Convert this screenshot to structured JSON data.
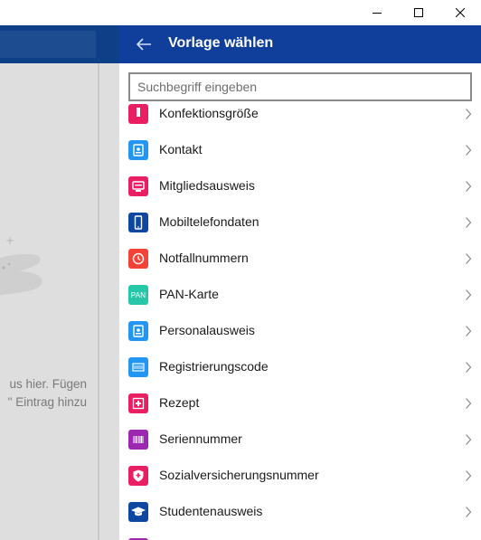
{
  "window": {
    "minimize_icon": "minimize-icon",
    "maximize_icon": "maximize-icon",
    "close_icon": "close-icon"
  },
  "background": {
    "text_line1": "us hier. Fügen",
    "text_line2": "\" Eintrag hinzu"
  },
  "panel": {
    "title": "Vorlage wählen",
    "back_icon": "arrow-left-icon",
    "search_placeholder": "Suchbegriff eingeben",
    "search_value": ""
  },
  "templates": [
    {
      "label": "Konfektionsgröße",
      "color": "#e91e63",
      "icon": "tshirt-icon"
    },
    {
      "label": "Kontakt",
      "color": "#2196f3",
      "icon": "contact-card-icon"
    },
    {
      "label": "Mitgliedsausweis",
      "color": "#e91e63",
      "icon": "membership-card-icon"
    },
    {
      "label": "Mobiltelefondaten",
      "color": "#0d47a1",
      "icon": "mobile-phone-icon"
    },
    {
      "label": "Notfallnummern",
      "color": "#f44336",
      "icon": "clock-icon"
    },
    {
      "label": "PAN-Karte",
      "color": "#26c6a8",
      "icon": "pan-icon",
      "icon_text": "PAN"
    },
    {
      "label": "Personalausweis",
      "color": "#2196f3",
      "icon": "id-card-icon"
    },
    {
      "label": "Registrierungscode",
      "color": "#2196f3",
      "icon": "registration-code-icon"
    },
    {
      "label": "Rezept",
      "color": "#e91e63",
      "icon": "medical-cross-icon"
    },
    {
      "label": "Seriennummer",
      "color": "#9c27b0",
      "icon": "barcode-icon"
    },
    {
      "label": "Sozialversicherungsnummer",
      "color": "#e91e63",
      "icon": "shield-icon"
    },
    {
      "label": "Studentenausweis",
      "color": "#0d47a1",
      "icon": "graduation-cap-icon"
    },
    {
      "label": "",
      "color": "#9c27b0",
      "icon": "generic-icon"
    }
  ]
}
